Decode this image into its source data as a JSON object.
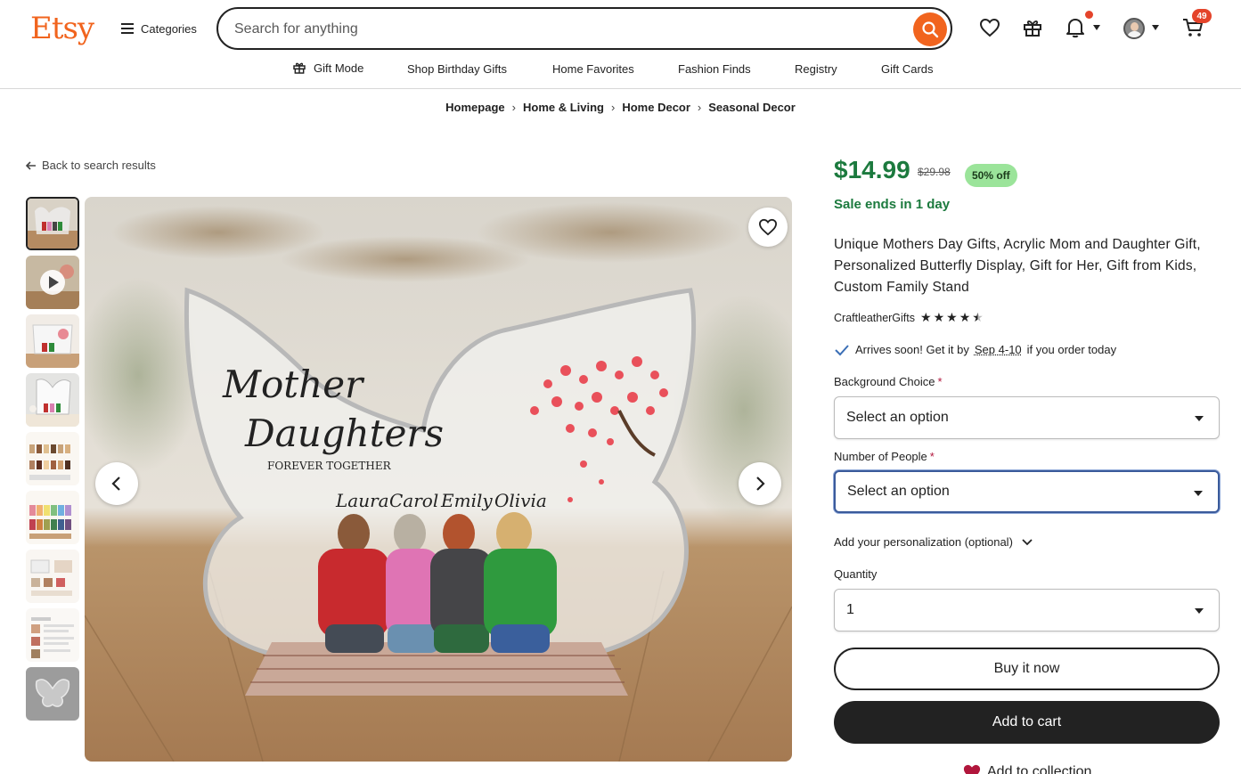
{
  "header": {
    "logo": "Etsy",
    "categories_label": "Categories",
    "search_placeholder": "Search for anything",
    "cart_count": "49"
  },
  "nav": {
    "items": [
      "Gift Mode",
      "Shop Birthday Gifts",
      "Home Favorites",
      "Fashion Finds",
      "Registry",
      "Gift Cards"
    ]
  },
  "breadcrumb": [
    "Homepage",
    "Home & Living",
    "Home Decor",
    "Seasonal Decor"
  ],
  "back_label": "Back to search results",
  "image": {
    "title_line1": "Mother",
    "title_line2": "Daughters",
    "tagline": "FOREVER TOGETHER",
    "names": [
      "Laura",
      "Carol",
      "Emily",
      "Olivia"
    ]
  },
  "product": {
    "price": "$14.99",
    "original_price": "$29.98",
    "discount_badge": "50% off",
    "sale_text": "Sale ends in 1 day",
    "title": "Unique Mothers Day Gifts, Acrylic Mom and Daughter Gift, Personalized Butterfly Display, Gift for Her, Gift from Kids, Custom Family Stand",
    "shop_name": "CraftleatherGifts",
    "rating": 4.5,
    "arrives_prefix": "Arrives soon! Get it by",
    "arrives_date": "Sep 4-10",
    "arrives_suffix": "if you order today"
  },
  "options": {
    "background_label": "Background Choice",
    "background_value": "Select an option",
    "people_label": "Number of People",
    "people_value": "Select an option",
    "personalization_label": "Add your personalization (optional)",
    "quantity_label": "Quantity",
    "quantity_value": "1",
    "required_mark": "*"
  },
  "actions": {
    "buy_now": "Buy it now",
    "add_to_cart": "Add to cart",
    "add_to_collection": "Add to collection"
  },
  "colors": {
    "brand": "#f1641e",
    "price_green": "#1c7a3e",
    "badge_green": "#9be49a",
    "notification": "#e4442b"
  }
}
